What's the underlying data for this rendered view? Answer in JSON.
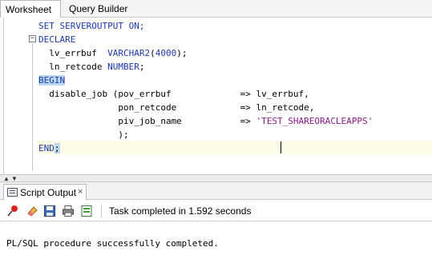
{
  "tabs": {
    "worksheet": "Worksheet",
    "query_builder": "Query Builder"
  },
  "editor": {
    "lines": [
      "SET SERVEROUTPUT ON;",
      "DECLARE",
      "  lv_errbuf  VARCHAR2(4000);",
      "  ln_retcode NUMBER;",
      "BEGIN",
      "  disable_job (pov_errbuf             => lv_errbuf,",
      "               pon_retcode            => ln_retcode,",
      "               piv_job_name           => 'TEST_SHAREORACLEAPPS'",
      "               );",
      "END;"
    ],
    "fold_marker": "−"
  },
  "output_panel": {
    "tab_label": "Script Output",
    "close_glyph": "×",
    "status": "Task completed in 1.592 seconds",
    "message": "PL/SQL procedure successfully completed.",
    "icons": [
      "pin-icon",
      "eraser-icon",
      "save-icon",
      "print-icon",
      "open-file-icon"
    ]
  },
  "colors": {
    "keyword": "#1c3aa9",
    "string": "#8b1a8b",
    "selection": "#bcd7f0",
    "current_line": "#fdfbe6"
  }
}
